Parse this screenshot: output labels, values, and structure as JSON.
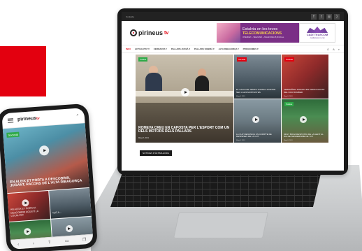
{
  "brand": {
    "name": "pirineus",
    "suffix": "tv"
  },
  "colors": {
    "accent": "#e3000f",
    "tag_green": "#2eaa48",
    "ad_purple": "#7a2f86"
  },
  "laptop": {
    "topbar": {
      "label": "Contacte",
      "social_icons": [
        "facebook-icon",
        "twitter-icon",
        "instagram-icon",
        "rss-icon"
      ]
    },
    "ad": {
      "line1": "Estalvia en les teves",
      "line2": "TELECOMUNICACIONS",
      "line3": "INTERNET + TELEVISIÓ + TELEFONIA  25,50 €/mes",
      "brand": "CADÍ TELECOM",
      "url": "caditelecom.cat"
    },
    "nav": {
      "items": [
        "INICI",
        "ACTUALITAT ▾",
        "CERDANYA ▾",
        "PALLARS JUSSÀ ▾",
        "PALLARS SOBIRÀ ▾",
        "ALTA RIBAGORÇA ▾",
        "PROGRAMES ▾"
      ],
      "icons": [
        "user-icon",
        "font-size-icon",
        "search-icon"
      ]
    },
    "featured": {
      "tag": "Política",
      "title": "ROMEVA CREU EN CAPOSTA PER L'ESPORT COM UN DELS MOTORS DELS PALLARS",
      "date": "Maig 8, 2019"
    },
    "tiles": [
      {
        "tag": "Societat",
        "title": "EL CANVI DE TEMPS TORNA A PORTAR NEU A LES MUNTANYES",
        "date": "Maig 8, 2019"
      },
      {
        "tag": "Societat",
        "title": "CEREMÒNIA POSADA EN MARXA AGOST DEL NOU BOMBER",
        "date": "Maig 8, 2019"
      },
      {
        "tag": "Societat",
        "title": "LA CUP DENUNCIA UN COMPTE DE DESPESES DE LA CUT",
        "date": "Maig 8, 2019"
      },
      {
        "tag": "Política",
        "title": "MOLT BONA RESPOSTA DE LA GENT AL DIA DE SENDERISME DE TOT",
        "date": "Maig 8, 2019"
      }
    ],
    "more_button": "NOTÍCIES D'ÚLTIMA HORA"
  },
  "phone": {
    "hero": {
      "tag": "Societat",
      "title": "EN ALEIX ET PORTA A DESCOBRIR, JUGANT, RACONS DE L'ALTA RIBAGORÇA"
    },
    "tiles": [
      {
        "title": "AN ALEIX ET PORTA A DESCOBRIR AGUSTÍ LA LOCALITAT"
      },
      {
        "title": "TOT A..."
      }
    ],
    "bottom_icons": [
      "back-icon",
      "forward-icon",
      "share-icon",
      "bookmark-icon",
      "tabs-icon"
    ]
  }
}
